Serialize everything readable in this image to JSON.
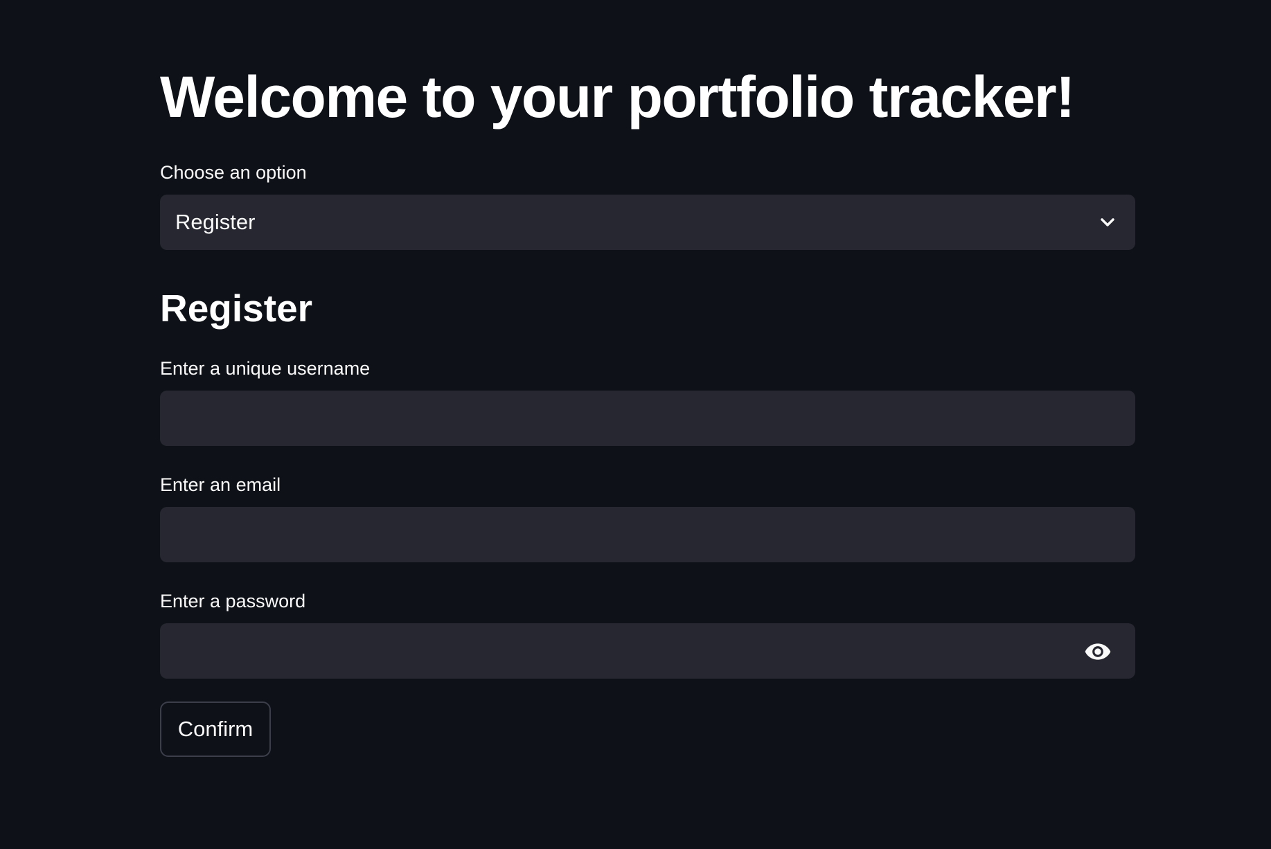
{
  "page": {
    "title": "Welcome to your portfolio tracker!"
  },
  "option_select": {
    "label": "Choose an option",
    "selected": "Register"
  },
  "register": {
    "heading": "Register",
    "username": {
      "label": "Enter a unique username",
      "value": ""
    },
    "email": {
      "label": "Enter an email",
      "value": ""
    },
    "password": {
      "label": "Enter a password",
      "value": ""
    },
    "confirm_label": "Confirm"
  },
  "icons": {
    "select_chevron": "chevron-down-icon",
    "password_toggle": "eye-icon"
  },
  "colors": {
    "background": "#0e1117",
    "input_background": "#262730",
    "text": "#fafafa",
    "button_border": "#3c3f4a"
  }
}
